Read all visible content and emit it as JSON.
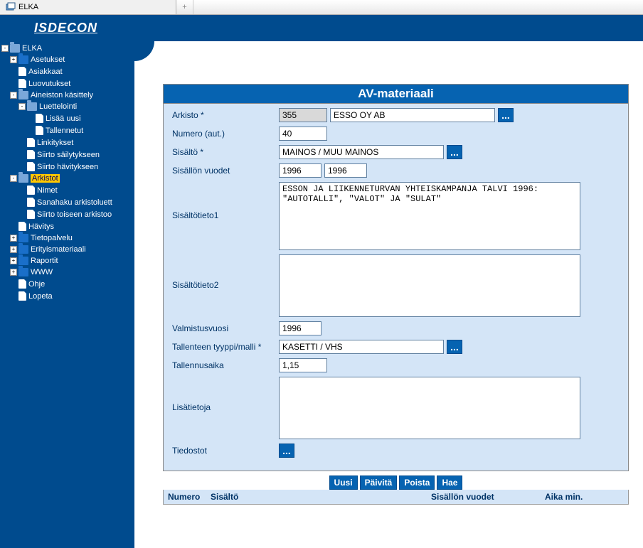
{
  "window": {
    "tab_title": "ELKA",
    "new_tab": "+"
  },
  "brand": "ISDECON",
  "tree": [
    {
      "depth": 0,
      "toggle": "-",
      "icon": "folder-open",
      "label": "ELKA"
    },
    {
      "depth": 1,
      "toggle": "+",
      "icon": "folder-closed",
      "label": "Asetukset"
    },
    {
      "depth": 1,
      "toggle": "",
      "icon": "page",
      "label": "Asiakkaat"
    },
    {
      "depth": 1,
      "toggle": "",
      "icon": "page",
      "label": "Luovutukset"
    },
    {
      "depth": 1,
      "toggle": "-",
      "icon": "folder-open",
      "label": "Aineiston käsittely"
    },
    {
      "depth": 2,
      "toggle": "-",
      "icon": "folder-open",
      "label": "Luettelointi"
    },
    {
      "depth": 3,
      "toggle": "",
      "icon": "page",
      "label": "Lisää uusi"
    },
    {
      "depth": 3,
      "toggle": "",
      "icon": "page",
      "label": "Tallennetut"
    },
    {
      "depth": 2,
      "toggle": "",
      "icon": "page",
      "label": "Linkitykset"
    },
    {
      "depth": 2,
      "toggle": "",
      "icon": "page",
      "label": "Siirto säilytykseen"
    },
    {
      "depth": 2,
      "toggle": "",
      "icon": "page",
      "label": "Siirto hävitykseen"
    },
    {
      "depth": 1,
      "toggle": "-",
      "icon": "folder-open",
      "label": "Arkistot",
      "selected": true
    },
    {
      "depth": 2,
      "toggle": "",
      "icon": "page",
      "label": "Nimet"
    },
    {
      "depth": 2,
      "toggle": "",
      "icon": "page",
      "label": "Sanahaku arkistoluett"
    },
    {
      "depth": 2,
      "toggle": "",
      "icon": "page",
      "label": "Siirto toiseen arkistoo"
    },
    {
      "depth": 1,
      "toggle": "",
      "icon": "page",
      "label": "Hävitys"
    },
    {
      "depth": 1,
      "toggle": "+",
      "icon": "folder-closed",
      "label": "Tietopalvelu"
    },
    {
      "depth": 1,
      "toggle": "+",
      "icon": "folder-closed",
      "label": "Erityismateriaali"
    },
    {
      "depth": 1,
      "toggle": "+",
      "icon": "folder-closed",
      "label": "Raportit"
    },
    {
      "depth": 1,
      "toggle": "+",
      "icon": "folder-closed",
      "label": "WWW"
    },
    {
      "depth": 1,
      "toggle": "",
      "icon": "page",
      "label": "Ohje"
    },
    {
      "depth": 1,
      "toggle": "",
      "icon": "page",
      "label": "Lopeta"
    }
  ],
  "form": {
    "title": "AV-materiaali",
    "labels": {
      "arkisto": "Arkisto *",
      "numero": "Numero (aut.)",
      "sisalto": "Sisältö *",
      "sisallon_vuodet": "Sisällön vuodet",
      "sisaltotieto1": "Sisältötieto1",
      "sisaltotieto2": "Sisältötieto2",
      "valmistusvuosi": "Valmistusvuosi",
      "tallenteen_tyyppi": "Tallenteen tyyppi/malli *",
      "tallennusaika": "Tallennusaika",
      "lisatietoja": "Lisätietoja",
      "tiedostot": "Tiedostot"
    },
    "values": {
      "arkisto_code": "355",
      "arkisto_name": "ESSO OY AB",
      "numero": "40",
      "sisalto": "MAINOS / MUU MAINOS",
      "vuosi_from": "1996",
      "vuosi_to": "1996",
      "sisaltotieto1": "ESSON JA LIIKENNETURVAN YHTEISKAMPANJA TALVI 1996: \"AUTOTALLI\", \"VALOT\" JA \"SULAT\"",
      "sisaltotieto2": "",
      "valmistusvuosi": "1996",
      "tallenteen_tyyppi": "KASETTI / VHS",
      "tallennusaika": "1,15",
      "lisatietoja": ""
    },
    "lookup": "..."
  },
  "actions": {
    "uusi": "Uusi",
    "paivita": "Päivitä",
    "poista": "Poista",
    "hae": "Hae"
  },
  "grid": {
    "numero": "Numero",
    "sisalto": "Sisältö",
    "vuodet": "Sisällön vuodet",
    "aika": "Aika min."
  }
}
